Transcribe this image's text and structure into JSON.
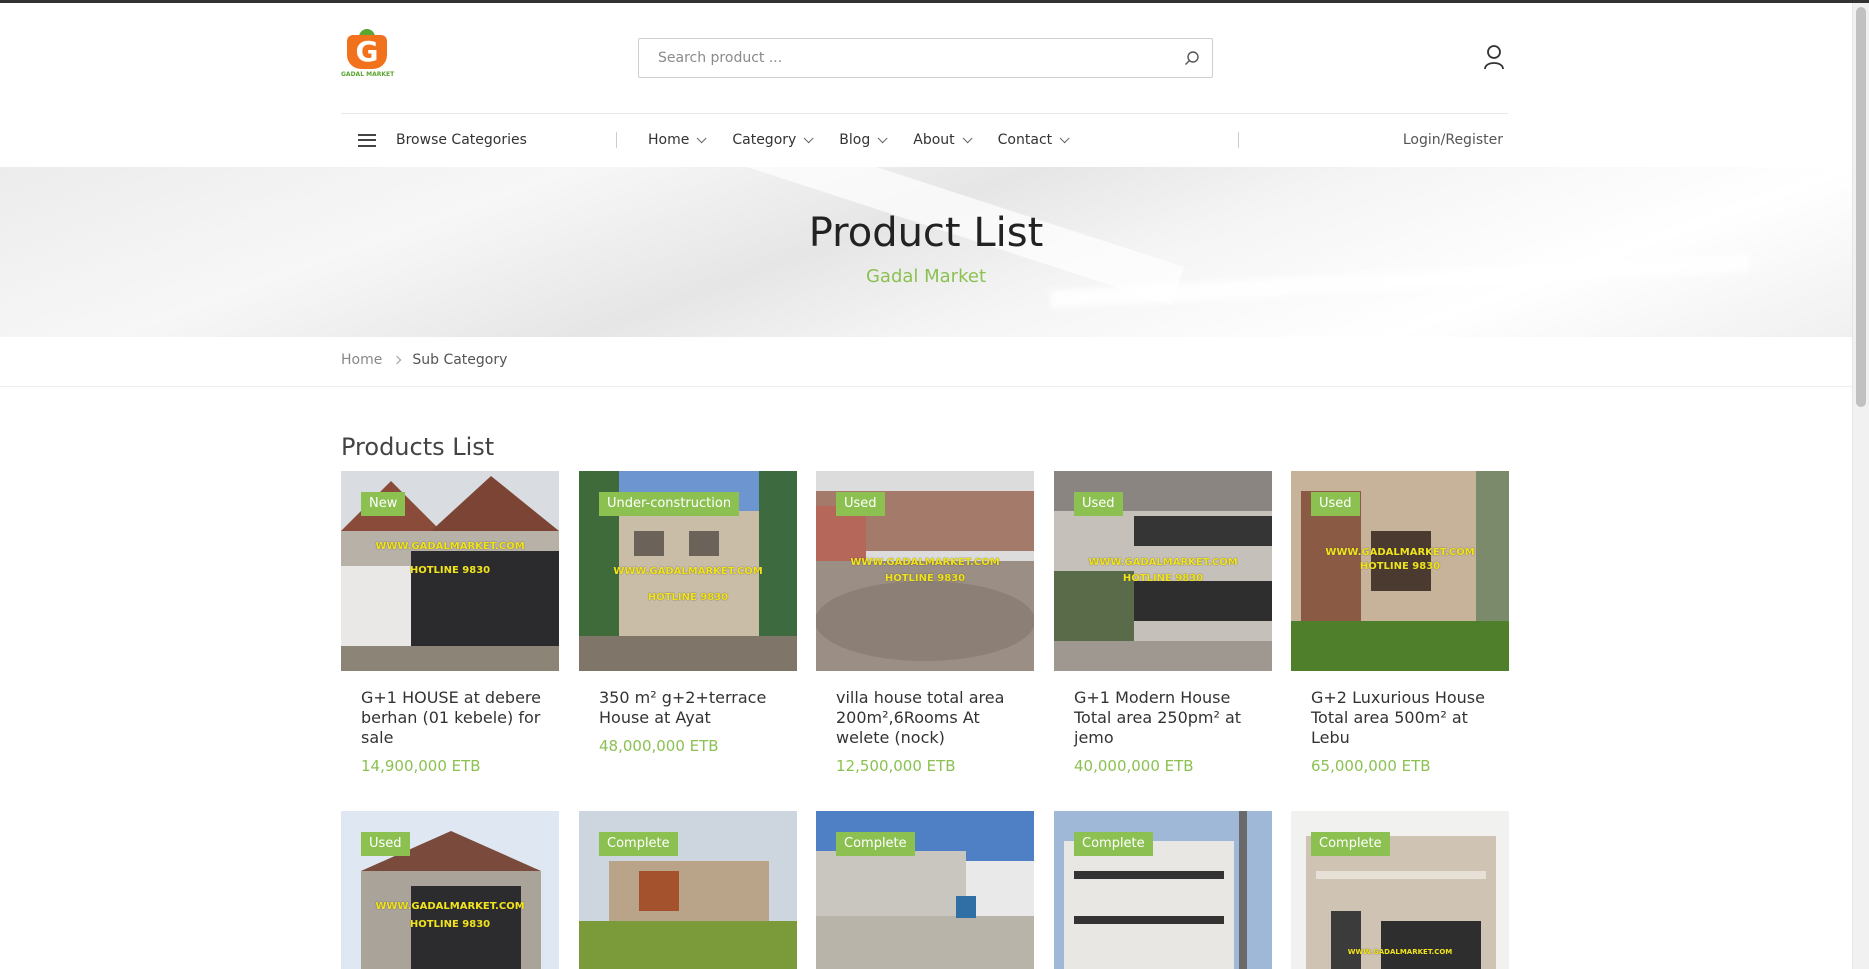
{
  "header": {
    "logo_text": "GADAL MARKET",
    "search_placeholder": "Search product ..."
  },
  "nav": {
    "browse_label": "Browse Categories",
    "menu": [
      {
        "label": "Home"
      },
      {
        "label": "Category"
      },
      {
        "label": "Blog"
      },
      {
        "label": "About"
      },
      {
        "label": "Contact"
      }
    ],
    "login_label": "Login/Register"
  },
  "hero": {
    "title": "Product List",
    "subtitle": "Gadal Market"
  },
  "breadcrumb": {
    "home": "Home",
    "current": "Sub Category"
  },
  "products_section": {
    "title": "Products List",
    "items": [
      {
        "badge": "New",
        "title": "G+1 HOUSE at debere berhan (01 kebele) for sale",
        "price": "14,900,000 ETB",
        "watermark1": "WWW.GADALMARKET.COM",
        "watermark2": "HOTLINE 9830"
      },
      {
        "badge": "Under-construction",
        "title": "350 m² g+2+terrace House at Ayat",
        "price": "48,000,000 ETB",
        "watermark1": "WWW.GADALMARKET.COM",
        "watermark2": "HOTLINE 9830"
      },
      {
        "badge": "Used",
        "title": "villa house total area 200m²,6Rooms At welete (nock)",
        "price": "12,500,000 ETB",
        "watermark1": "WWW.GADALMARKET.COM",
        "watermark2": "HOTLINE 9830"
      },
      {
        "badge": "Used",
        "title": "G+1 Modern House Total area 250pm² at jemo",
        "price": "40,000,000 ETB",
        "watermark1": "WWW.GADALMARKET.COM",
        "watermark2": "HOTLINE 9830"
      },
      {
        "badge": "Used",
        "title": "G+2 Luxurious House Total area 500m² at Lebu",
        "price": "65,000,000 ETB",
        "watermark1": "WWW.GADALMARKET.COM",
        "watermark2": "HOTLINE 9830"
      },
      {
        "badge": "Used",
        "watermark1": "WWW.GADALMARKET.COM",
        "watermark2": "HOTLINE 9830"
      },
      {
        "badge": "Complete"
      },
      {
        "badge": "Complete"
      },
      {
        "badge": "Complete"
      },
      {
        "badge": "Complete",
        "watermark1": "WWW.GADALMARKET.COM"
      }
    ]
  },
  "colors": {
    "accent": "#8cc152",
    "badge_bg": "#8cc152",
    "logo_orange": "#f2711c"
  }
}
